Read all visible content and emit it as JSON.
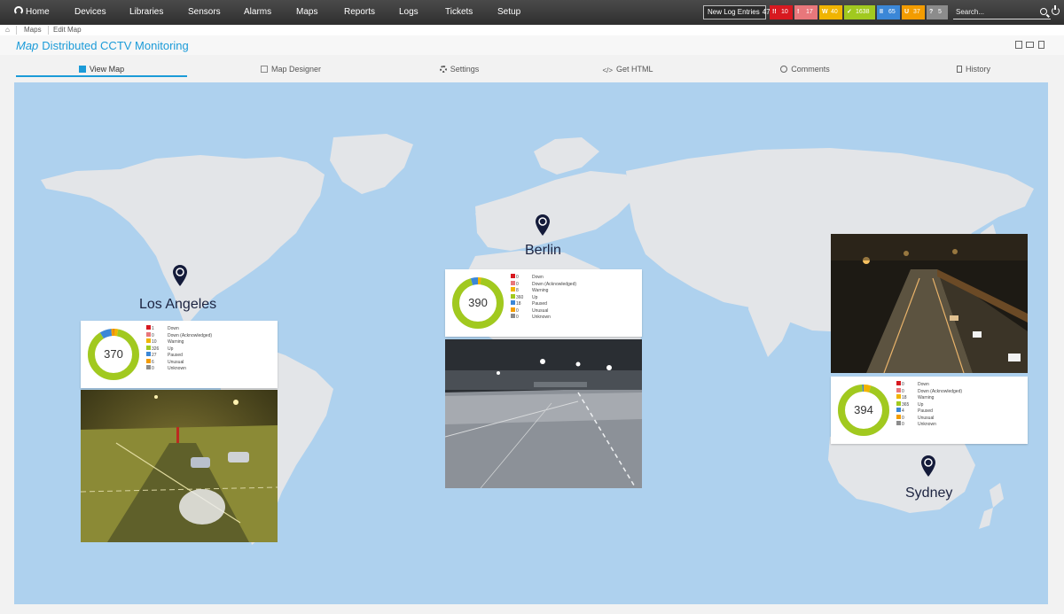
{
  "nav": {
    "items": [
      "Home",
      "Devices",
      "Libraries",
      "Sensors",
      "Alarms",
      "Maps",
      "Reports",
      "Logs",
      "Tickets",
      "Setup"
    ],
    "log_entries_label": "New Log Entries",
    "log_entries_count": "47",
    "search_placeholder": "Search...",
    "badges": [
      {
        "symbol": "!!",
        "count": "10",
        "color": "#d71920"
      },
      {
        "symbol": "!",
        "count": "17",
        "color": "#e8777b"
      },
      {
        "symbol": "W",
        "count": "40",
        "color": "#f0b400"
      },
      {
        "symbol": "✓",
        "count": "1638",
        "color": "#a1c91f"
      },
      {
        "symbol": "II",
        "count": "65",
        "color": "#3b87d7"
      },
      {
        "symbol": "U",
        "count": "37",
        "color": "#f39c00"
      },
      {
        "symbol": "?",
        "count": "5",
        "color": "#8c8c8c"
      }
    ]
  },
  "breadcrumb": [
    "Maps",
    "Edit Map"
  ],
  "page": {
    "title_kind": "Map",
    "title": "Distributed CCTV Monitoring"
  },
  "tabs": [
    "View Map",
    "Map Designer",
    "Settings",
    "Get HTML",
    "Comments",
    "History"
  ],
  "colors": {
    "accent": "#1b9bd8",
    "ocean": "#aed1ee",
    "land": "#e3e5e8",
    "pin": "#141b3a"
  },
  "legend_labels": [
    "Down",
    "Down (Acknowledged)",
    "Warning",
    "Up",
    "Paused",
    "Unusual",
    "Unknown"
  ],
  "legend_colors": [
    "#d71920",
    "#e8777b",
    "#f0b400",
    "#a1c91f",
    "#3b87d7",
    "#f39c00",
    "#8c8c8c"
  ],
  "locations": [
    {
      "city": "Los Angeles",
      "total": "370",
      "counts": [
        "1",
        "0",
        "10",
        "326",
        "27",
        "6",
        "0"
      ]
    },
    {
      "city": "Berlin",
      "total": "390",
      "counts": [
        "0",
        "0",
        "8",
        "360",
        "18",
        "0",
        "0"
      ]
    },
    {
      "city": "Sydney",
      "total": "394",
      "counts": [
        "0",
        "0",
        "18",
        "365",
        "4",
        "0",
        "0"
      ]
    }
  ]
}
